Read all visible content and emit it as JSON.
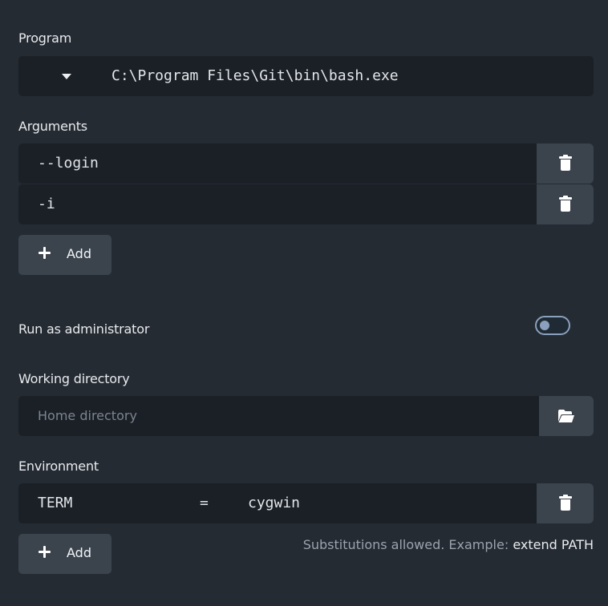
{
  "program": {
    "label": "Program",
    "value": "C:\\Program Files\\Git\\bin\\bash.exe"
  },
  "arguments": {
    "label": "Arguments",
    "items": [
      "--login",
      "-i"
    ],
    "add_label": "Add"
  },
  "run_as_admin": {
    "label": "Run as administrator",
    "enabled": false
  },
  "working_directory": {
    "label": "Working directory",
    "placeholder": "Home directory",
    "value": ""
  },
  "environment": {
    "label": "Environment",
    "items": [
      {
        "key": "TERM",
        "separator": "=",
        "value": "cygwin"
      }
    ],
    "add_label": "Add",
    "hint_prefix": "Substitutions allowed. Example:",
    "hint_example": "extend PATH"
  },
  "icons": {
    "dropdown": "chevron-down-icon",
    "delete": "trash-icon",
    "add": "plus-icon",
    "browse": "folder-open-icon"
  },
  "colors": {
    "background": "#252b33",
    "field": "#1b2027",
    "button": "#3b434d",
    "toggle_accent": "#8aa0bd"
  }
}
